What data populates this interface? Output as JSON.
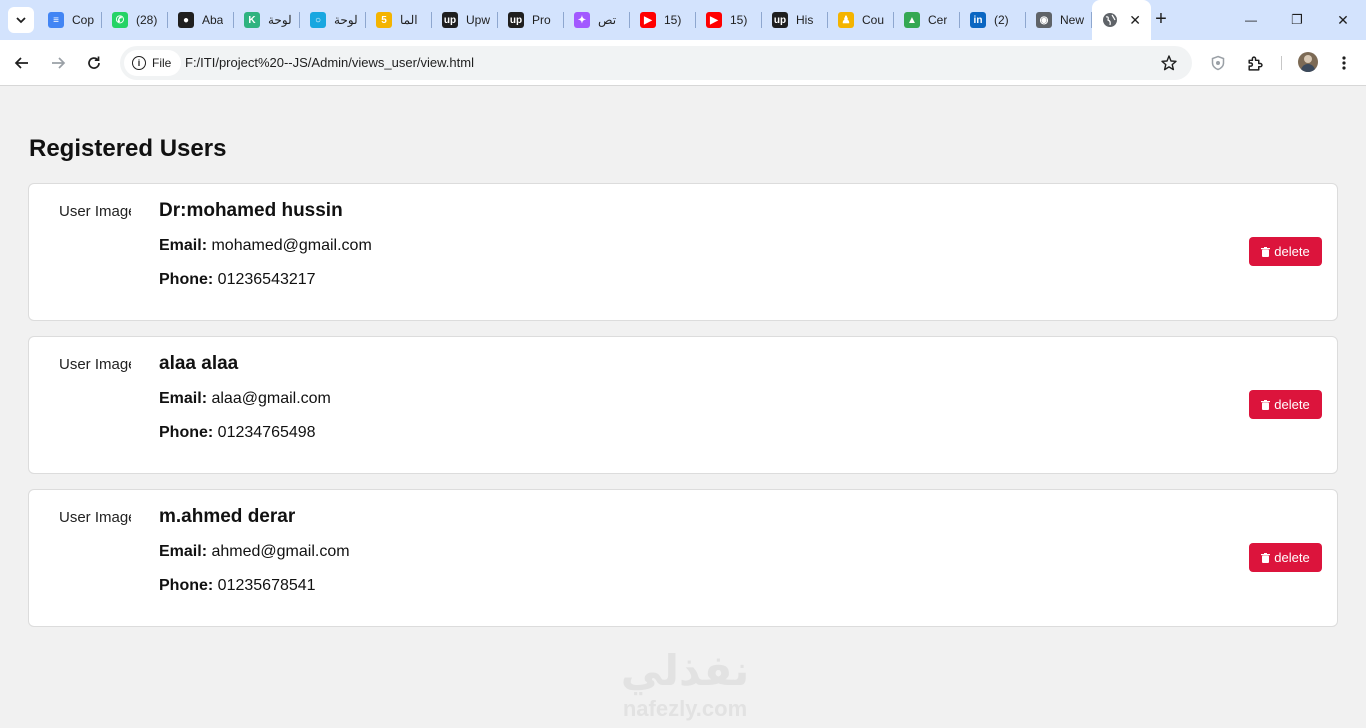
{
  "browser": {
    "tabs": [
      {
        "title": "Cop",
        "icon": "google-docs-icon",
        "color": "#4285f4",
        "glyph": "≡"
      },
      {
        "title": "(28)",
        "icon": "whatsapp-icon",
        "color": "#25d366",
        "glyph": "✆"
      },
      {
        "title": "Aba",
        "icon": "github-icon",
        "color": "#1f1f1f",
        "glyph": "●"
      },
      {
        "title": "لوحة",
        "icon": "k-logo-icon",
        "color": "#2fb380",
        "glyph": "K"
      },
      {
        "title": "لوحة",
        "icon": "ring-icon",
        "color": "#19a7e0",
        "glyph": "○"
      },
      {
        "title": "الما",
        "icon": "number-five-icon",
        "color": "#f4b400",
        "glyph": "5"
      },
      {
        "title": "Upw",
        "icon": "upwork-icon",
        "color": "#1f1f1f",
        "glyph": "up"
      },
      {
        "title": "Pro",
        "icon": "upwork-icon",
        "color": "#1f1f1f",
        "glyph": "up"
      },
      {
        "title": "تص",
        "icon": "figma-icon",
        "color": "#a259ff",
        "glyph": "✦"
      },
      {
        "title": "15)",
        "icon": "youtube-icon",
        "color": "#ff0000",
        "glyph": "▶"
      },
      {
        "title": "15)",
        "icon": "youtube-icon",
        "color": "#ff0000",
        "glyph": "▶"
      },
      {
        "title": "His",
        "icon": "upwork-icon",
        "color": "#1f1f1f",
        "glyph": "up"
      },
      {
        "title": "Cou",
        "icon": "person-icon",
        "color": "#f4b400",
        "glyph": "♟"
      },
      {
        "title": "Cer",
        "icon": "google-drive-icon",
        "color": "#34a853",
        "glyph": "▲"
      },
      {
        "title": "(2)",
        "icon": "linkedin-icon",
        "color": "#0a66c2",
        "glyph": "in"
      },
      {
        "title": "New",
        "icon": "chrome-icon",
        "color": "#5f6368",
        "glyph": "◉"
      }
    ],
    "active_tab": {
      "icon": "globe-icon",
      "close": "✕"
    },
    "new_tab": "+",
    "window": {
      "minimize": "—",
      "restore": "❐",
      "close": "✕"
    },
    "omnibox": {
      "chip": "File",
      "info": "i",
      "url": "F:/ITI/project%20--JS/Admin/views_user/view.html"
    }
  },
  "page": {
    "title": "Registered Users",
    "image_alt": "User Image",
    "email_label": "Email:",
    "phone_label": "Phone:",
    "delete_label": "delete",
    "users": [
      {
        "name": "Dr:mohamed hussin",
        "email": "mohamed@gmail.com",
        "phone": "01236543217"
      },
      {
        "name": "alaa alaa",
        "email": "alaa@gmail.com",
        "phone": "01234765498"
      },
      {
        "name": "m.ahmed derar",
        "email": "ahmed@gmail.com",
        "phone": "01235678541"
      }
    ]
  },
  "watermark": {
    "arabic": "نفذلي",
    "latin": "nafezly.com"
  },
  "colors": {
    "delete_button": "#dc143c",
    "tab_strip": "#d3e3fd",
    "page_background": "#f1f1f1"
  }
}
